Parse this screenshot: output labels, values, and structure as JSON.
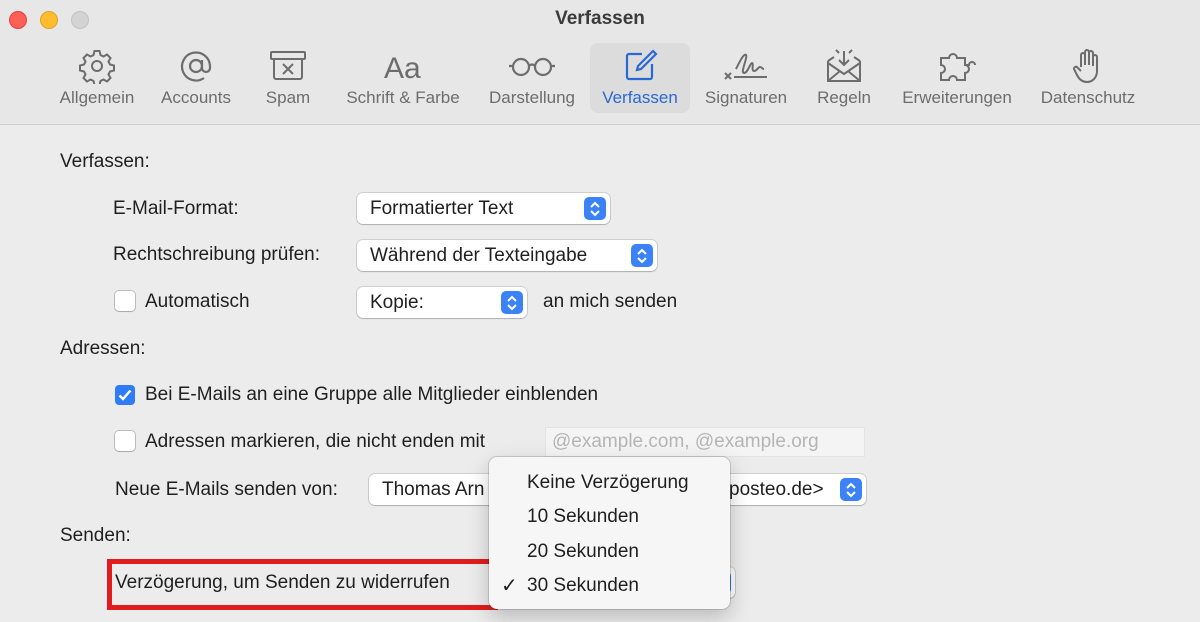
{
  "window": {
    "title": "Verfassen"
  },
  "toolbar": {
    "tabs": [
      {
        "label": "Allgemein",
        "icon": "gear-icon"
      },
      {
        "label": "Accounts",
        "icon": "at-icon"
      },
      {
        "label": "Spam",
        "icon": "junk-tray-icon"
      },
      {
        "label": "Schrift & Farbe",
        "icon": "font-icon"
      },
      {
        "label": "Darstellung",
        "icon": "glasses-icon"
      },
      {
        "label": "Verfassen",
        "icon": "compose-icon",
        "active": true
      },
      {
        "label": "Signaturen",
        "icon": "signature-icon"
      },
      {
        "label": "Regeln",
        "icon": "rules-envelope-icon"
      },
      {
        "label": "Erweiterungen",
        "icon": "puzzle-icon"
      },
      {
        "label": "Datenschutz",
        "icon": "hand-icon"
      }
    ]
  },
  "compose": {
    "section_label": "Verfassen:",
    "format_label": "E-Mail-Format:",
    "format_value": "Formatierter Text",
    "spell_label": "Rechtschreibung prüfen:",
    "spell_value": "Während der Texteingabe",
    "auto_label": "Automatisch",
    "auto_checked": false,
    "auto_value": "Kopie:",
    "auto_suffix": "an mich senden"
  },
  "addresses": {
    "section_label": "Adressen:",
    "group_label": "Bei E-Mails an eine Gruppe alle Mitglieder einblenden",
    "group_checked": true,
    "mark_label": "Adressen markieren, die nicht enden mit",
    "mark_checked": false,
    "mark_placeholder": "@example.com, @example.org",
    "from_label": "Neue E-Mails senden von:",
    "from_value_start": "Thomas Arn",
    "from_value_end": "posteo.de>"
  },
  "send": {
    "section_label": "Senden:",
    "undo_label": "Verzögerung, um Senden zu widerrufen",
    "undo_options": [
      {
        "label": "Keine Verzögerung",
        "selected": false
      },
      {
        "label": "10 Sekunden",
        "selected": false
      },
      {
        "label": "20 Sekunden",
        "selected": false
      },
      {
        "label": "30 Sekunden",
        "selected": true
      }
    ],
    "check_mark": "✓"
  },
  "colors": {
    "accent": "#2f7cf6",
    "active_tab_text": "#2a68d4",
    "highlight_box": "#e21c1c"
  }
}
